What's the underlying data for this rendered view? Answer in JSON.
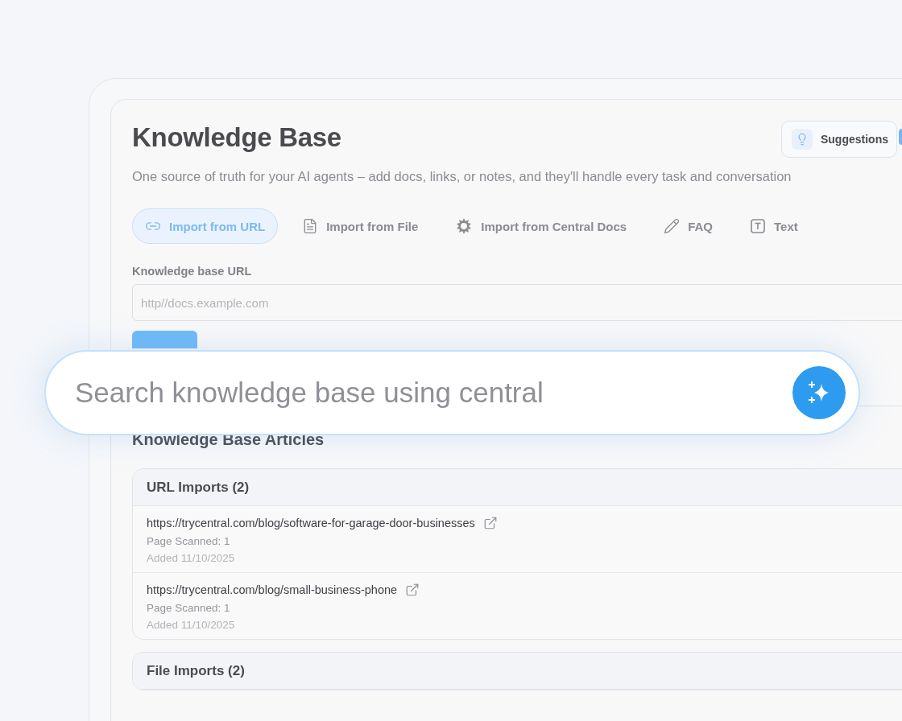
{
  "header": {
    "title": "Knowledge Base",
    "subtitle": "One source of truth for your AI agents – add docs, links, or notes, and they'll handle every task and conversation",
    "suggestions_button": "Suggestions"
  },
  "tabs": [
    {
      "kind": "link",
      "label": "Import from URL",
      "selected": true
    },
    {
      "kind": "file",
      "label": "Import from File",
      "selected": false
    },
    {
      "kind": "central",
      "label": "Import from Central Docs",
      "selected": false
    },
    {
      "kind": "pencil",
      "label": "FAQ",
      "selected": false
    },
    {
      "kind": "text",
      "label": "Text",
      "selected": false
    }
  ],
  "url_form": {
    "label": "Knowledge base URL",
    "placeholder": "http//docs.example.com"
  },
  "search": {
    "placeholder": "Search knowledge base using central"
  },
  "articles": {
    "title": "Knowledge Base Articles",
    "sections": [
      {
        "title": "URL Imports (2)",
        "items": [
          {
            "url": "https://trycentral.com/blog/software-for-garage-door-businesses",
            "scanned": "Page Scanned: 1",
            "added": "Added 11/10/2025"
          },
          {
            "url": "https://trycentral.com/blog/small-business-phone",
            "scanned": "Page Scanned: 1",
            "added": "Added 11/10/2025"
          }
        ]
      },
      {
        "title": "File Imports (2)"
      }
    ]
  }
}
